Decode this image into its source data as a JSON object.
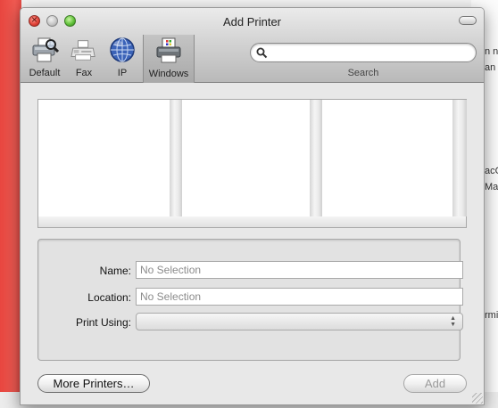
{
  "window": {
    "title": "Add Printer"
  },
  "toolbar": {
    "items": [
      {
        "label": "Default",
        "icon": "printer-search-icon"
      },
      {
        "label": "Fax",
        "icon": "fax-icon"
      },
      {
        "label": "IP",
        "icon": "globe-icon"
      },
      {
        "label": "Windows",
        "icon": "windows-printer-icon",
        "selected": true
      }
    ],
    "search": {
      "placeholder": "",
      "label": "Search"
    }
  },
  "form": {
    "name_label": "Name:",
    "name_value": "No Selection",
    "location_label": "Location:",
    "location_value": "No Selection",
    "print_using_label": "Print Using:",
    "print_using_value": ""
  },
  "buttons": {
    "more_printers": "More Printers…",
    "add": "Add"
  },
  "background": {
    "right_snippets": [
      "n n",
      "an",
      "acC",
      "Ma",
      "rmi"
    ]
  },
  "colors": {
    "desktop_red": "#f05a52",
    "disabled_text": "#9a9a9a"
  }
}
